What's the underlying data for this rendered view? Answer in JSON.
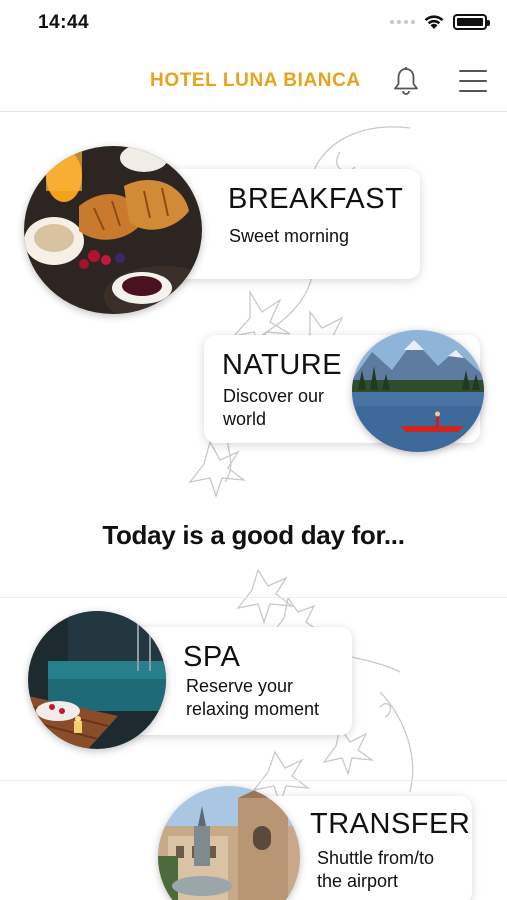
{
  "status": {
    "time": "14:44"
  },
  "header": {
    "title": "HOTEL LUNA BIANCA"
  },
  "banner": {
    "text": "Today is a good day for..."
  },
  "cards": [
    {
      "title": "BREAKFAST",
      "subtitle": "Sweet morning"
    },
    {
      "title": "NATURE",
      "subtitle_line1": "Discover our",
      "subtitle_line2": "world"
    },
    {
      "title": "SPA",
      "subtitle_line1": "Reserve your",
      "subtitle_line2": "relaxing moment"
    },
    {
      "title": "TRANSFER",
      "subtitle_line1": "Shuttle from/to",
      "subtitle_line2": "the airport"
    }
  ],
  "colors": {
    "brand": "#e8a21d",
    "text": "#111111",
    "divider": "#e2e2e2"
  },
  "icons": [
    "wifi-icon",
    "battery-icon",
    "bell-icon",
    "hamburger-menu-icon"
  ]
}
